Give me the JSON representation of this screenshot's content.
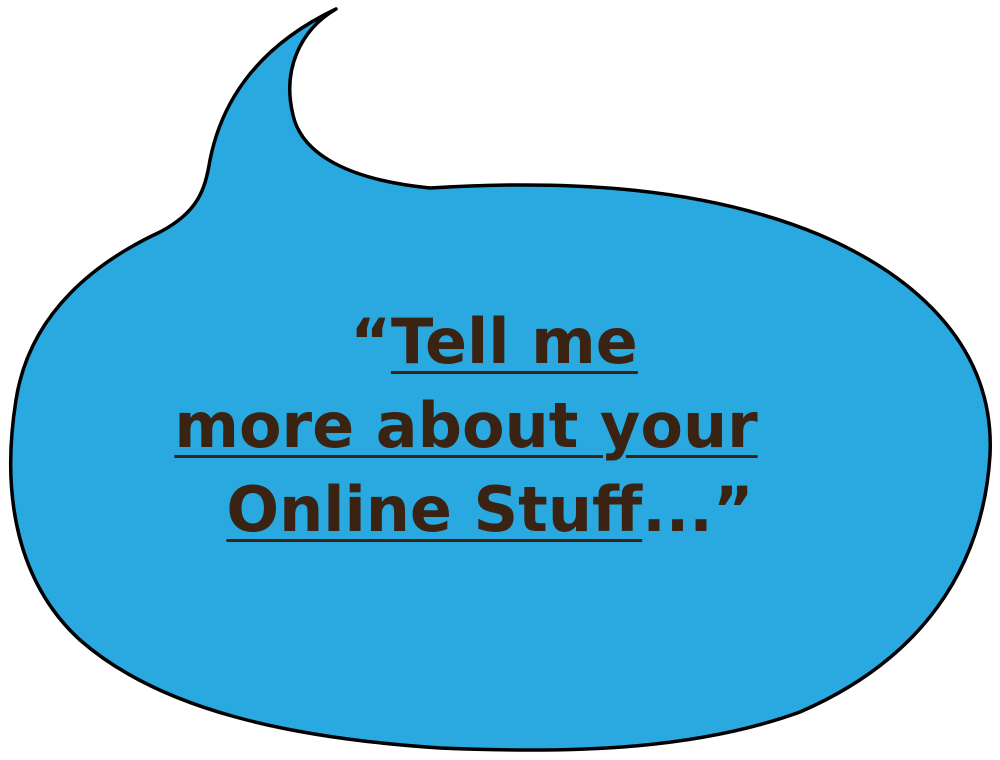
{
  "bubble": {
    "fill_color": "#29a9e0",
    "outline_color": "#000000",
    "text_color": "#3b2314",
    "line1_quote": "“",
    "line1_text": "Tell me",
    "line2_text": "more about your",
    "line3_text": "Online Stuff",
    "line3_tail": "...”"
  }
}
